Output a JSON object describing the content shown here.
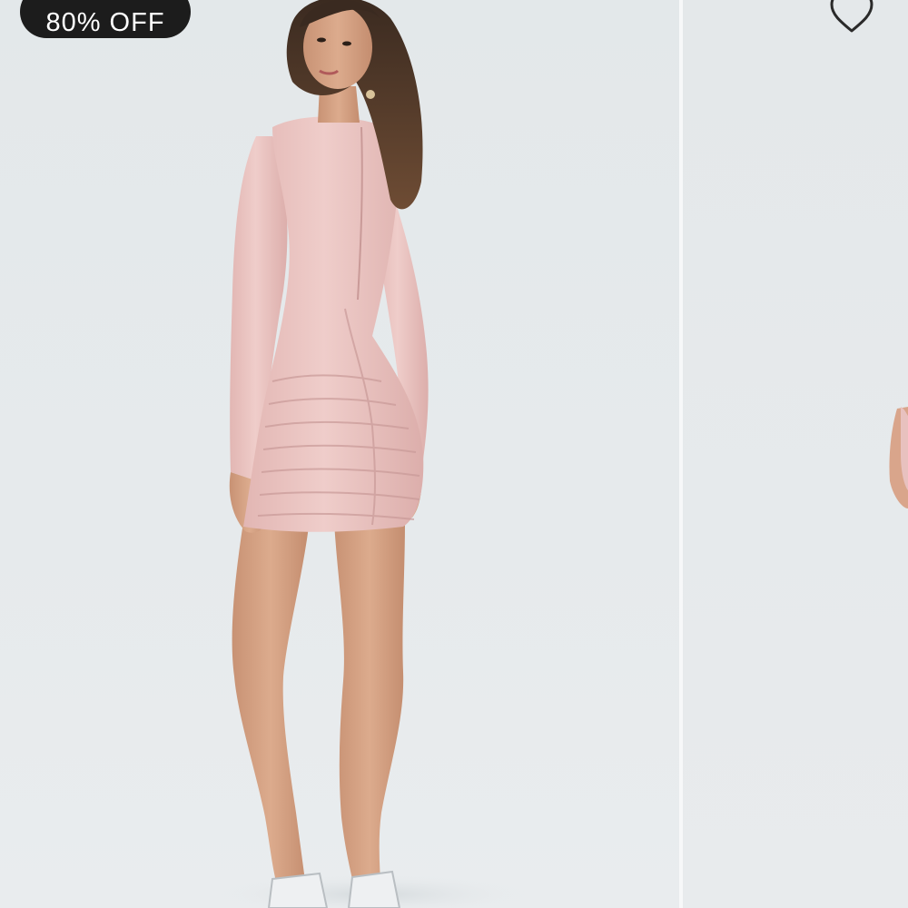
{
  "product_gallery": {
    "badge": {
      "label": "80% OFF"
    },
    "wishlist": {
      "icon": "heart-outline-icon"
    },
    "main_image": {
      "subject": "model-pink-ruched-long-sleeve-mini-dress-back-view"
    },
    "next_image": {
      "subject": "partial-next-product-photo"
    },
    "colors": {
      "badge_bg": "#1c1c1c",
      "badge_text": "#ffffff",
      "background": "#e4e8ea",
      "dress": "#e8bfbd"
    }
  }
}
